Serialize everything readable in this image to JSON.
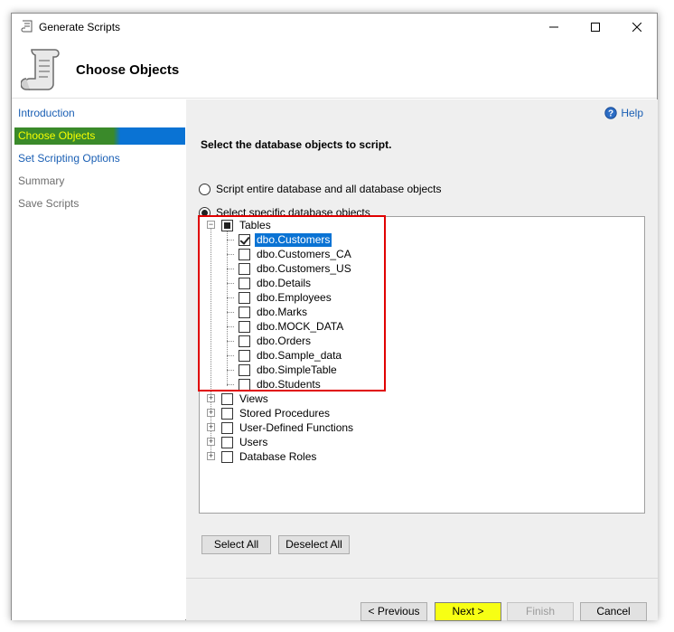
{
  "window": {
    "title": "Generate Scripts"
  },
  "header": {
    "title": "Choose Objects"
  },
  "nav": {
    "items": [
      {
        "label": "Introduction",
        "state": "link"
      },
      {
        "label": "Choose Objects",
        "state": "active"
      },
      {
        "label": "Set Scripting Options",
        "state": "link"
      },
      {
        "label": "Summary",
        "state": "dim"
      },
      {
        "label": "Save Scripts",
        "state": "dim"
      }
    ]
  },
  "help": {
    "label": "Help"
  },
  "content": {
    "section_title": "Select the database objects to script.",
    "radio_entire": "Script entire database and all database objects",
    "radio_specific": "Select specific database objects",
    "selected_radio": "specific"
  },
  "tree": {
    "tables_label": "Tables",
    "tables": [
      {
        "label": "dbo.Customers",
        "checked": true,
        "selected": true
      },
      {
        "label": "dbo.Customers_CA",
        "checked": false
      },
      {
        "label": "dbo.Customers_US",
        "checked": false
      },
      {
        "label": "dbo.Details",
        "checked": false
      },
      {
        "label": "dbo.Employees",
        "checked": false
      },
      {
        "label": "dbo.Marks",
        "checked": false
      },
      {
        "label": "dbo.MOCK_DATA",
        "checked": false
      },
      {
        "label": "dbo.Orders",
        "checked": false
      },
      {
        "label": "dbo.Sample_data",
        "checked": false
      },
      {
        "label": "dbo.SimpleTable",
        "checked": false
      },
      {
        "label": "dbo.Students",
        "checked": false
      }
    ],
    "groups": [
      {
        "label": "Views"
      },
      {
        "label": "Stored Procedures"
      },
      {
        "label": "User-Defined Functions"
      },
      {
        "label": "Users"
      },
      {
        "label": "Database Roles"
      }
    ]
  },
  "buttons": {
    "select_all": "Select All",
    "deselect_all": "Deselect All",
    "previous": "< Previous",
    "next": "Next >",
    "finish": "Finish",
    "cancel": "Cancel"
  },
  "colors": {
    "active_nav_green": "#3a8a2a",
    "active_nav_blue": "#0a73d4",
    "active_nav_text": "#f6ff00",
    "next_button_highlight": "#f7ff14",
    "annotation_red": "#e00000"
  }
}
